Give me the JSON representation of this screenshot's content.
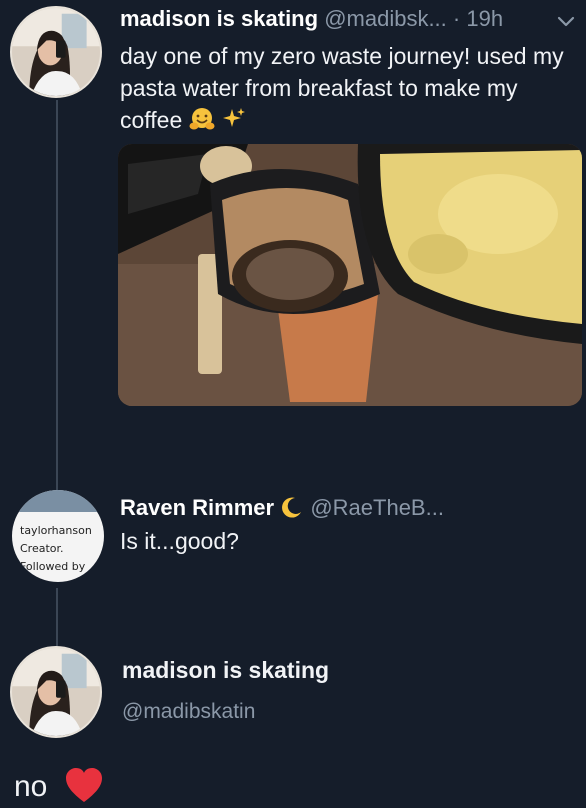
{
  "tweet": {
    "author_name": "madison is skating",
    "author_handle": "@madibsk...",
    "separator": "·",
    "time": "19h",
    "text": "day one of my zero waste journey! used my pasta water from breakfast to make my coffee",
    "emojis": [
      "hugging-face-icon",
      "sparkles-icon"
    ]
  },
  "reply": {
    "author_name": "Raven Rimmer",
    "author_handle": "@RaeTheB...",
    "text": "Is it...good?",
    "badge_icon": "crescent-moon-icon",
    "card_avatar": {
      "line1": "taylorhanson",
      "line2": "Creator.",
      "line3": "Followed by"
    }
  },
  "profile": {
    "name": "madison is skating",
    "handle": "@madibskatin"
  },
  "caption": {
    "text": "no",
    "icon": "red-heart-icon"
  },
  "colors": {
    "background": "#151d2a",
    "muted_text": "#8b98a8",
    "heart": "#e8323e"
  }
}
